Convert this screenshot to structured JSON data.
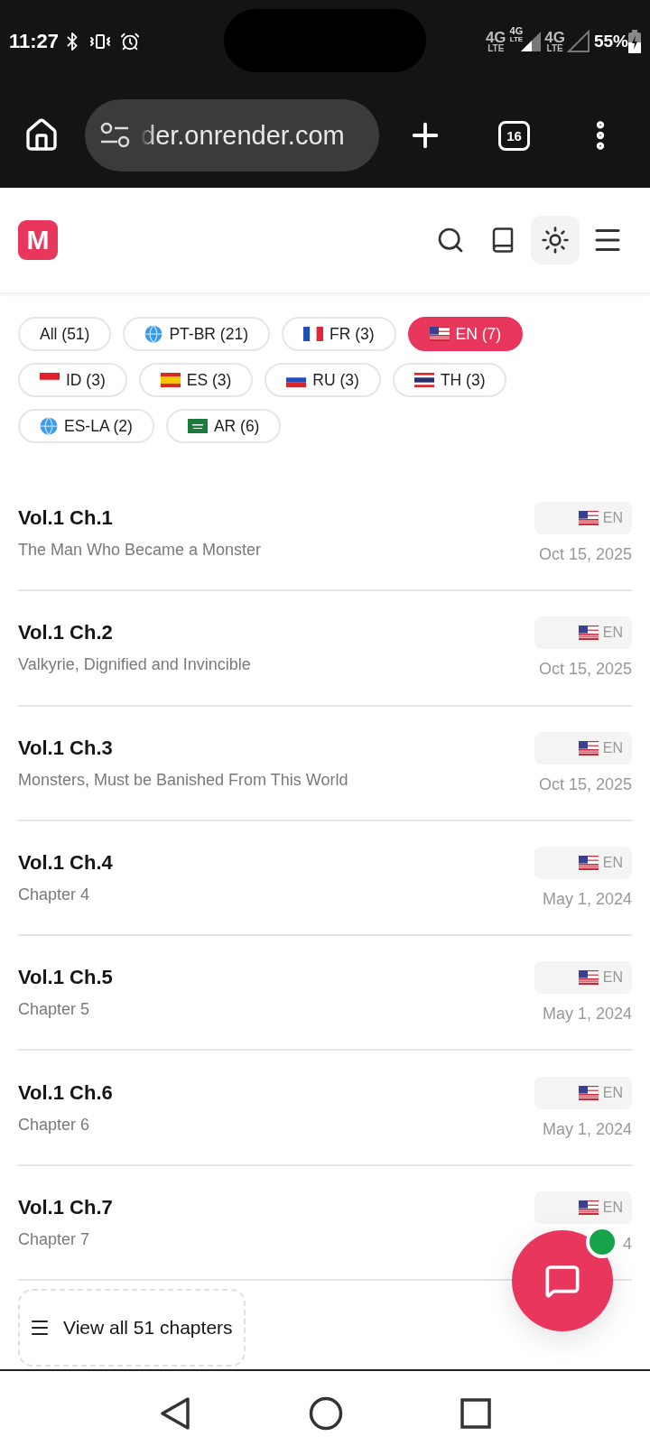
{
  "status_bar": {
    "time": "11:27",
    "network": [
      {
        "kind": "tech",
        "top": "4G",
        "bottom": "LTE"
      },
      {
        "kind": "mini-tech",
        "top": "4G",
        "bottom": "LTE"
      },
      {
        "kind": "signal-full"
      },
      {
        "kind": "tech",
        "top": "4G",
        "bottom": "LTE"
      },
      {
        "kind": "signal-empty"
      }
    ],
    "battery": "55%"
  },
  "browser": {
    "url": "der.onrender.com",
    "tab_count": "16"
  },
  "header": {
    "logo": "M"
  },
  "filters": [
    {
      "label": "All (51)",
      "kind": "plain",
      "selected": false
    },
    {
      "label": "PT-BR (21)",
      "kind": "globe",
      "selected": false
    },
    {
      "label": "FR (3)",
      "kind": "fr",
      "selected": false
    },
    {
      "label": "EN (7)",
      "kind": "us",
      "selected": true
    },
    {
      "label": "ID (3)",
      "kind": "id",
      "selected": false
    },
    {
      "label": "ES (3)",
      "kind": "es",
      "selected": false
    },
    {
      "label": "RU (3)",
      "kind": "ru",
      "selected": false
    },
    {
      "label": "TH (3)",
      "kind": "th",
      "selected": false
    },
    {
      "label": "ES-LA (2)",
      "kind": "globe",
      "selected": false
    },
    {
      "label": "AR (6)",
      "kind": "sa",
      "selected": false
    }
  ],
  "chapters": [
    {
      "title": "Vol.1 Ch.1",
      "subtitle": "The Man Who Became a Monster",
      "kind": "us",
      "lang": "EN",
      "date": "Oct 15, 2025"
    },
    {
      "title": "Vol.1 Ch.2",
      "subtitle": "Valkyrie, Dignified and Invincible",
      "kind": "us",
      "lang": "EN",
      "date": "Oct 15, 2025"
    },
    {
      "title": "Vol.1 Ch.3",
      "subtitle": "Monsters, Must be Banished From This World",
      "kind": "us",
      "lang": "EN",
      "date": "Oct 15, 2025"
    },
    {
      "title": "Vol.1 Ch.4",
      "subtitle": "Chapter 4",
      "kind": "us",
      "lang": "EN",
      "date": "May 1, 2024"
    },
    {
      "title": "Vol.1 Ch.5",
      "subtitle": "Chapter 5",
      "kind": "us",
      "lang": "EN",
      "date": "May 1, 2024"
    },
    {
      "title": "Vol.1 Ch.6",
      "subtitle": "Chapter 6",
      "kind": "us",
      "lang": "EN",
      "date": "May 1, 2024"
    },
    {
      "title": "Vol.1 Ch.7",
      "subtitle": "Chapter 7",
      "kind": "us",
      "lang": "EN",
      "date": "4"
    }
  ],
  "view_all": "View all 51 chapters",
  "chat": {
    "online": true
  }
}
